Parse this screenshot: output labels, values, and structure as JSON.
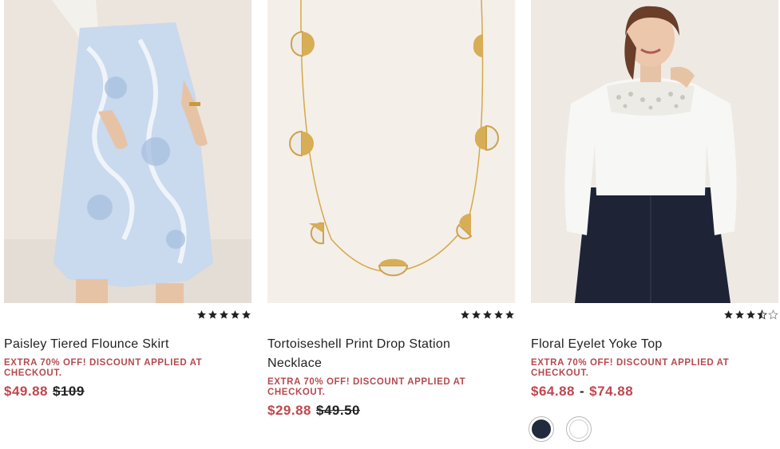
{
  "products": [
    {
      "name": "Paisley Tiered Flounce Skirt",
      "promo": "EXTRA 70% OFF! DISCOUNT APPLIED AT CHECKOUT.",
      "sale_price": "$49.88",
      "original_price": "$109",
      "rating": 5
    },
    {
      "name": "Tortoiseshell Print Drop Station Necklace",
      "promo": "EXTRA 70% OFF! DISCOUNT APPLIED AT CHECKOUT.",
      "sale_price": "$29.88",
      "original_price": "$49.50",
      "rating": 5
    },
    {
      "name": "Floral Eyelet Yoke Top",
      "promo": "EXTRA 70% OFF! DISCOUNT APPLIED AT CHECKOUT.",
      "price_low": "$64.88",
      "price_separator": "-",
      "price_high": "$74.88",
      "rating": 3.5,
      "swatches": [
        "navy",
        "white"
      ]
    }
  ],
  "colors": {
    "sale": "#c0474e",
    "promo": "#b54a4f",
    "text": "#222222",
    "swatch_navy": "#222a3d",
    "swatch_white": "#ffffff"
  }
}
